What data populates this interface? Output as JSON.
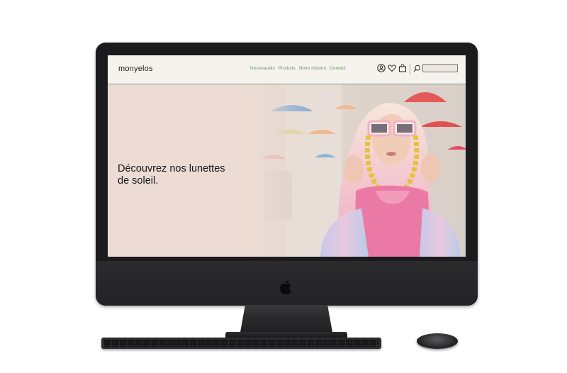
{
  "site": {
    "brand": "monyelos",
    "nav": [
      "Nouveautés",
      "Produits",
      "Notre histoire",
      "Contact"
    ],
    "icons": [
      "user-icon",
      "heart-icon",
      "shopping-bag-icon",
      "search-icon"
    ],
    "search": {
      "value": "",
      "placeholder": ""
    },
    "accent_color": "#6c9a63",
    "hero": {
      "title_line1": "Découvrez nos lunettes",
      "title_line2": "de soleil.",
      "background_color": "#ecdcd5"
    }
  },
  "device": {
    "type": "desktop-monitor-mockup",
    "logo": "apple-icon"
  }
}
